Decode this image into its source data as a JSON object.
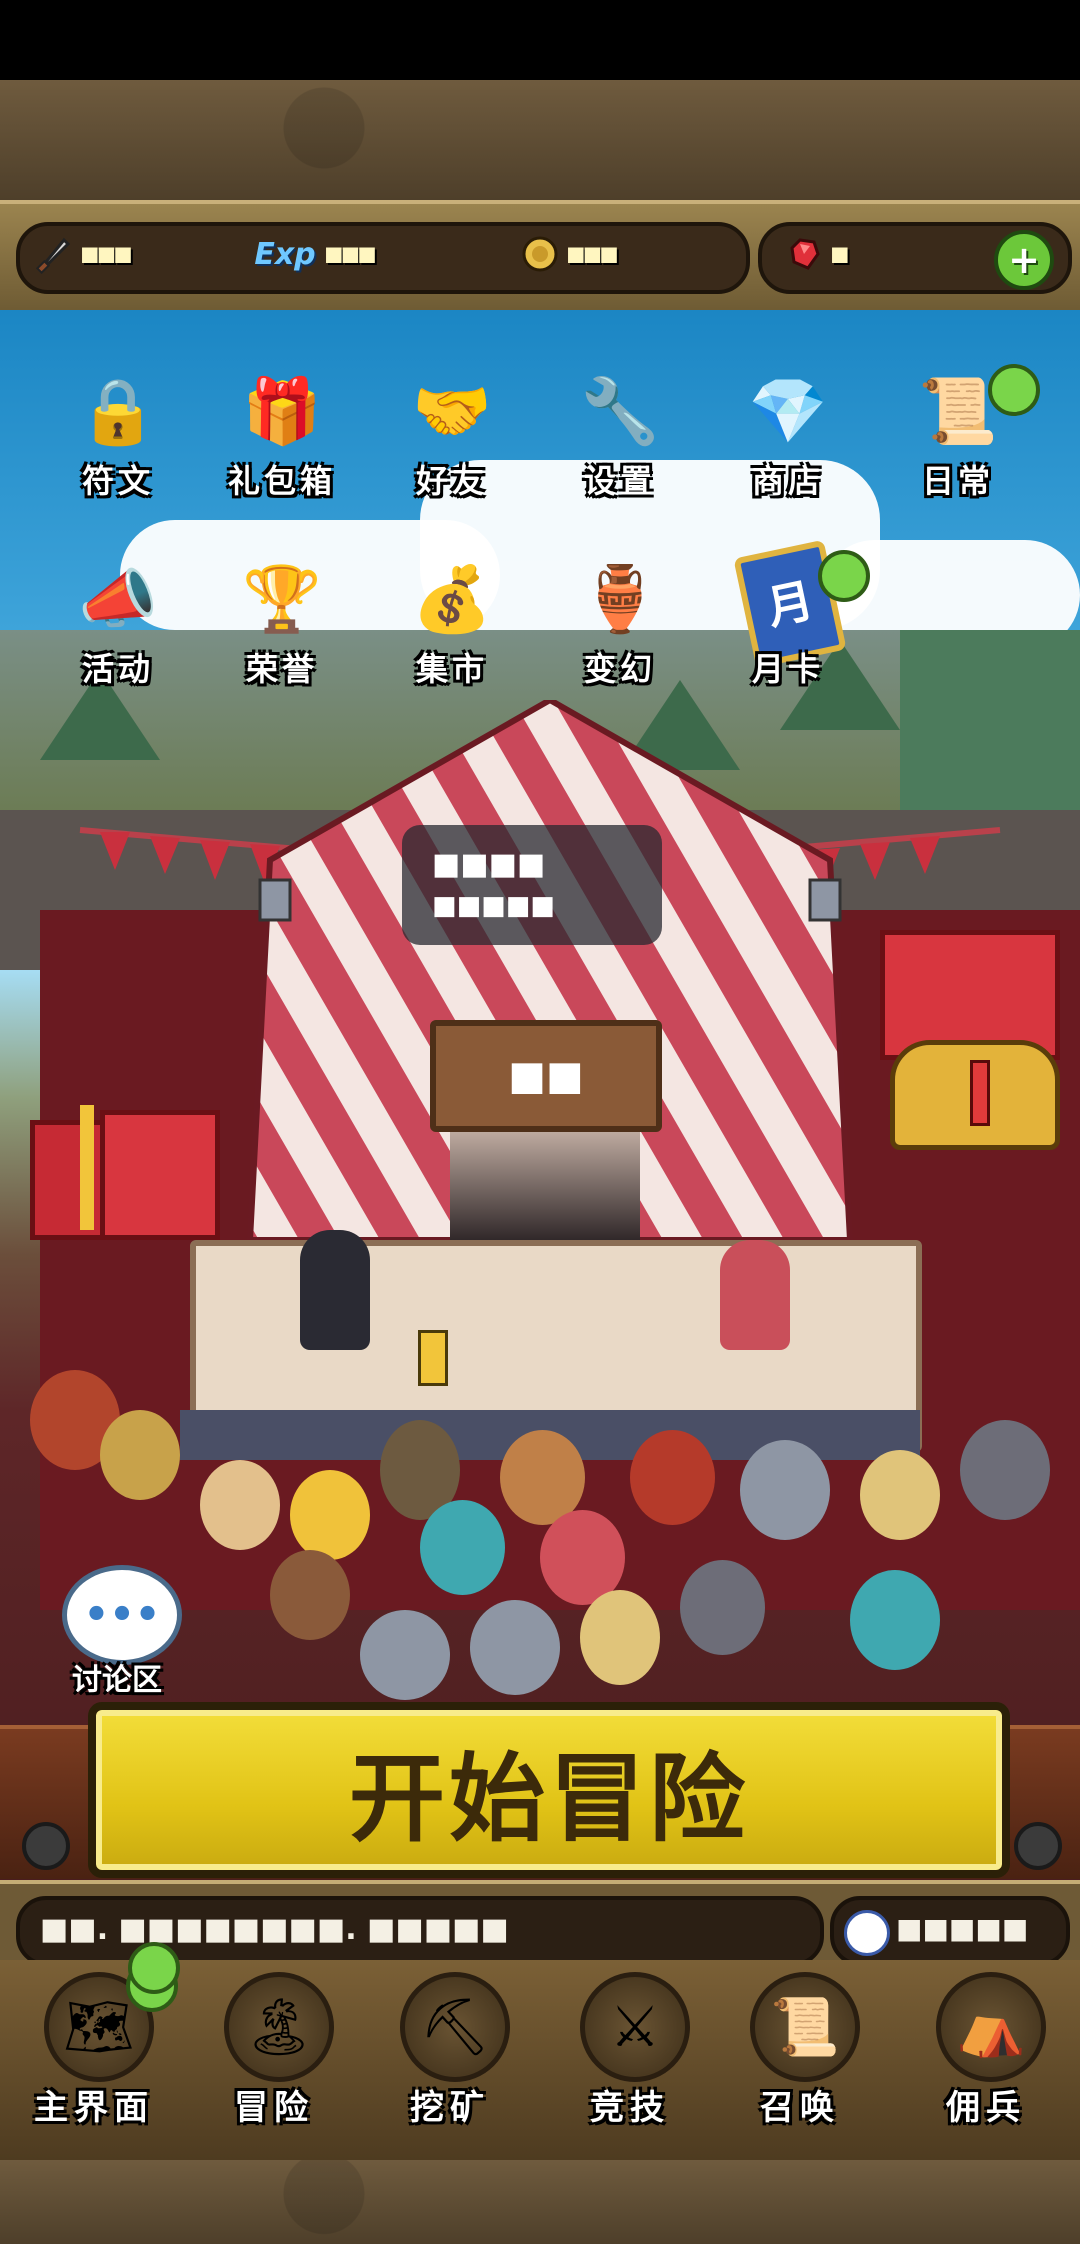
{
  "top_bar": {
    "attack": {
      "icon": "sword-icon",
      "value": "■■■"
    },
    "exp": {
      "icon": "exp-icon",
      "label": "Exp",
      "value": "■■■"
    },
    "gold": {
      "icon": "gold-coin-icon",
      "value": "■■■"
    },
    "gems": {
      "icon": "red-gem-icon",
      "value": "■"
    },
    "add_label": "+"
  },
  "menu": {
    "row1": [
      {
        "label": "符文",
        "icon": "locked-rune-icon",
        "art": "🔒"
      },
      {
        "label": "礼包箱",
        "icon": "gift-box-icon",
        "art": "🎁"
      },
      {
        "label": "好友",
        "icon": "handshake-heart-icon",
        "art": "🤝"
      },
      {
        "label": "设置",
        "icon": "wrench-icon",
        "art": "🔧"
      },
      {
        "label": "商店",
        "icon": "ruby-shop-icon",
        "art": "💎"
      },
      {
        "label": "日常",
        "icon": "scroll-quill-icon",
        "art": "📜"
      }
    ],
    "row2": [
      {
        "label": "活动",
        "icon": "megaphone-icon",
        "art": "📣"
      },
      {
        "label": "荣誉",
        "icon": "trophy-icon",
        "art": "🏆"
      },
      {
        "label": "集市",
        "icon": "money-bag-icon",
        "art": "💰"
      },
      {
        "label": "变幻",
        "icon": "transform-jar-icon",
        "art": "🏺"
      },
      {
        "label": "月卡",
        "icon": "month-card-icon",
        "art": "月"
      }
    ]
  },
  "tent": {
    "tooltip_line1": "■■■■",
    "tooltip_line2": "■■■■■",
    "sign": "■■"
  },
  "chat": {
    "label": "讨论区",
    "bubble": "•••"
  },
  "start_button": "开始冒险",
  "message_bar": "■■. ■■■■■■■■. ■■■■■",
  "clock_value": "■■■■■",
  "nav": [
    {
      "label": "主界面",
      "icon": "map-scroll-icon",
      "art": "🗺"
    },
    {
      "label": "冒险",
      "icon": "island-icon",
      "art": "🏝"
    },
    {
      "label": "挖矿",
      "icon": "locked-pickaxe-icon",
      "art": "⛏"
    },
    {
      "label": "竞技",
      "icon": "locked-arena-icon",
      "art": "⚔"
    },
    {
      "label": "召唤",
      "icon": "summon-scroll-icon",
      "art": "📜"
    },
    {
      "label": "佣兵",
      "icon": "tent-icon",
      "art": "⛺"
    }
  ],
  "colors": {
    "sky": "#4fb2e4",
    "start_button": "#e1c316",
    "badge": "#7ad54a",
    "carpet": "#6a1a21"
  }
}
